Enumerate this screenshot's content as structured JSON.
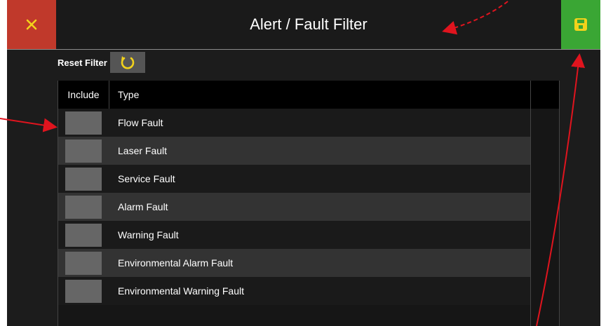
{
  "header": {
    "title": "Alert / Fault Filter",
    "close_icon": "close-icon",
    "save_icon": "save-icon"
  },
  "reset": {
    "label": "Reset Filter",
    "icon": "reset-icon"
  },
  "table": {
    "columns": [
      "Include",
      "Type"
    ],
    "rows": [
      {
        "type": "Flow Fault",
        "included": false
      },
      {
        "type": "Laser Fault",
        "included": false
      },
      {
        "type": "Service Fault",
        "included": false
      },
      {
        "type": "Alarm Fault",
        "included": false
      },
      {
        "type": "Warning Fault",
        "included": false
      },
      {
        "type": "Environmental Alarm Fault",
        "included": false
      },
      {
        "type": "Environmental Warning Fault",
        "included": false
      }
    ]
  },
  "colors": {
    "close": "#c0392b",
    "save": "#3aa634",
    "accent": "#f2d21b",
    "annotation": "#e0141e"
  }
}
